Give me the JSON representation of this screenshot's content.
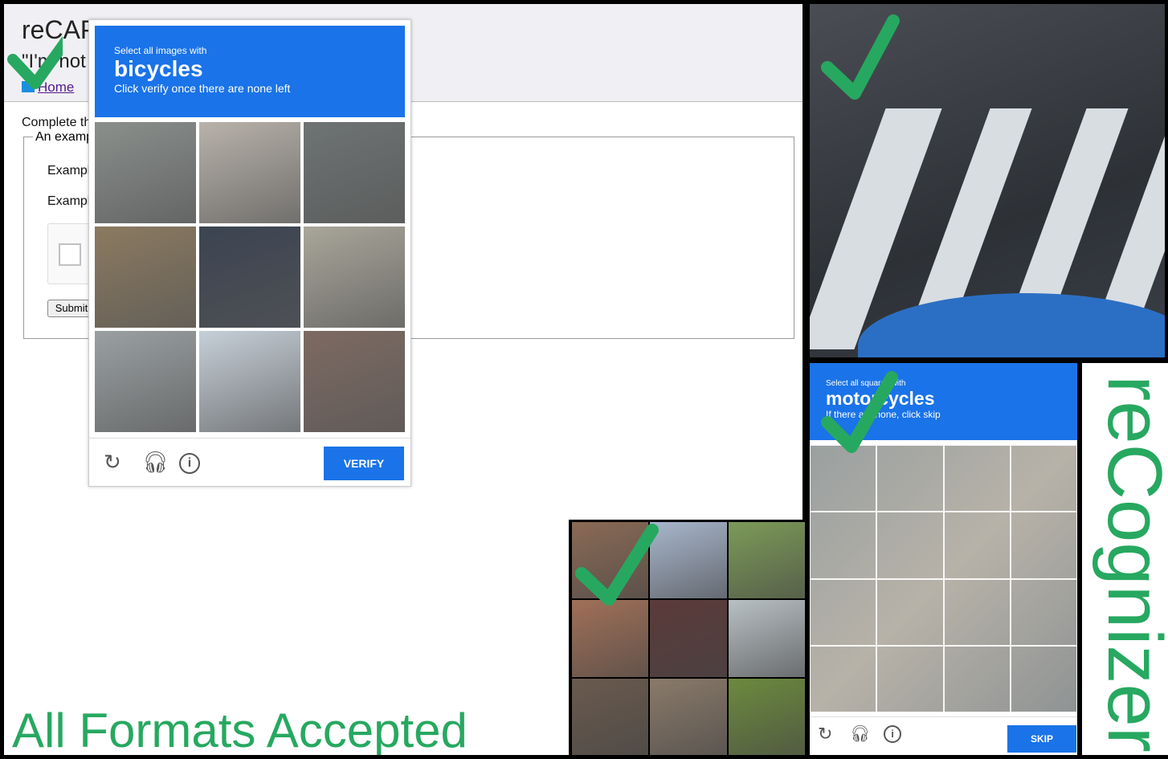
{
  "demo_page": {
    "title": "reCAPTCHA demo",
    "subtitle": "\"I'm not a robot\"",
    "home_link": "Home",
    "instruction": "Complete the",
    "legend": "An example",
    "example_1": "Example",
    "example_2": "Example",
    "submit": "Submit"
  },
  "captcha_bicycles": {
    "prompt": "Select all images with",
    "target": "bicycles",
    "hint": "Click verify once there are none left",
    "tiles": [
      "#8a8f8c",
      "#b8b2aa",
      "#6e7373",
      "#8b7a60",
      "#3c4452",
      "#a9a69a",
      "#9aa0a2",
      "#c6cfd8",
      "#7d6a62"
    ],
    "icons": [
      "reload-icon",
      "headphones-icon",
      "info-icon"
    ],
    "verify": "VERIFY",
    "color": "#1a73e8"
  },
  "captcha_motorcycles": {
    "prompt": "Select all squares with",
    "target": "motorcycles",
    "hint": "If there are none, click skip",
    "skip": "SKIP"
  },
  "mini_grid": {
    "tiles": [
      "#8a6a55",
      "#a8b6cc",
      "#7c9a58",
      "#a07058",
      "#5c3a3a",
      "#b8c0c4",
      "#6a5a4e",
      "#8a7a6a",
      "#6c8a3e"
    ]
  },
  "tagline": "All Formats Accepted",
  "brand": "reCognizer",
  "accent_green": "#27a860"
}
